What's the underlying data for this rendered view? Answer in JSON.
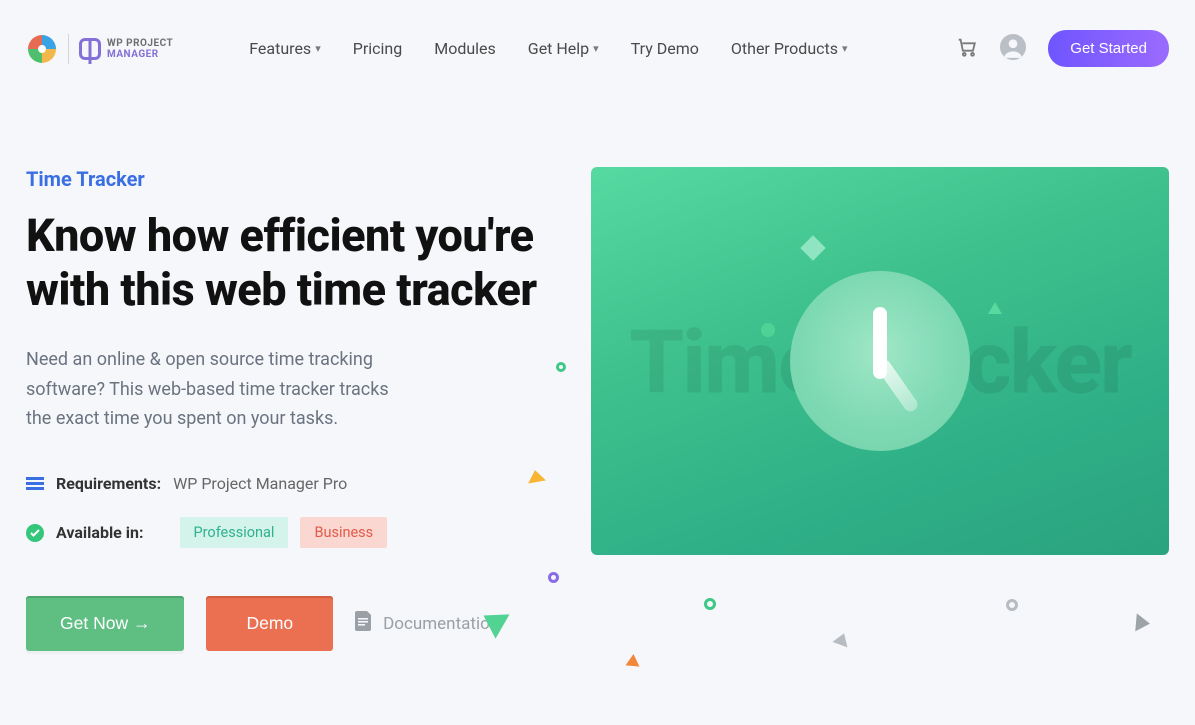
{
  "brand": {
    "line1": "WP PROJECT",
    "line2": "MANAGER"
  },
  "nav": {
    "features": "Features",
    "pricing": "Pricing",
    "modules": "Modules",
    "get_help": "Get Help",
    "try_demo": "Try Demo",
    "other_products": "Other Products"
  },
  "header": {
    "get_started": "Get Started"
  },
  "hero": {
    "eyebrow": "Time Tracker",
    "headline": "Know how efficient you're with this web time tracker",
    "subtext": "Need an online & open source time tracking software? This web-based time tracker tracks the exact time you spent on your tasks.",
    "image_watermark": "Time Tracker"
  },
  "meta": {
    "requirements_label": "Requirements:",
    "requirements_value": "WP Project Manager Pro",
    "available_label": "Available in:",
    "tag_professional": "Professional",
    "tag_business": "Business"
  },
  "cta": {
    "get_now": "Get Now",
    "demo": "Demo",
    "documentation": "Documentation"
  }
}
